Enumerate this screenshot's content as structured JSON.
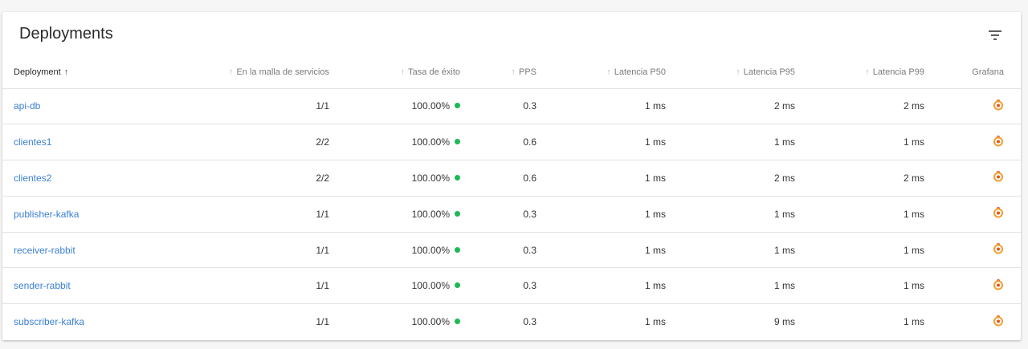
{
  "card": {
    "title": "Deployments"
  },
  "columns": {
    "deployment": "Deployment",
    "mesh": "En la malla de servicios",
    "success": "Tasa de éxito",
    "pps": "PPS",
    "p50": "Latencia P50",
    "p95": "Latencia P95",
    "p99": "Latencia P99",
    "grafana": "Grafana"
  },
  "sort_arrow": "↑",
  "colors": {
    "link": "#3a7fd3",
    "success_dot": "#1db954",
    "grafana_outer": "#f0a030",
    "grafana_inner": "#e8551f"
  },
  "rows": [
    {
      "name": "api-db",
      "mesh": "1/1",
      "success": "100.00%",
      "pps": "0.3",
      "p50": "1 ms",
      "p95": "2 ms",
      "p99": "2 ms"
    },
    {
      "name": "clientes1",
      "mesh": "2/2",
      "success": "100.00%",
      "pps": "0.6",
      "p50": "1 ms",
      "p95": "1 ms",
      "p99": "1 ms"
    },
    {
      "name": "clientes2",
      "mesh": "2/2",
      "success": "100.00%",
      "pps": "0.6",
      "p50": "1 ms",
      "p95": "2 ms",
      "p99": "2 ms"
    },
    {
      "name": "publisher-kafka",
      "mesh": "1/1",
      "success": "100.00%",
      "pps": "0.3",
      "p50": "1 ms",
      "p95": "1 ms",
      "p99": "1 ms"
    },
    {
      "name": "receiver-rabbit",
      "mesh": "1/1",
      "success": "100.00%",
      "pps": "0.3",
      "p50": "1 ms",
      "p95": "1 ms",
      "p99": "1 ms"
    },
    {
      "name": "sender-rabbit",
      "mesh": "1/1",
      "success": "100.00%",
      "pps": "0.3",
      "p50": "1 ms",
      "p95": "1 ms",
      "p99": "1 ms"
    },
    {
      "name": "subscriber-kafka",
      "mesh": "1/1",
      "success": "100.00%",
      "pps": "0.3",
      "p50": "1 ms",
      "p95": "9 ms",
      "p99": "1 ms"
    }
  ]
}
